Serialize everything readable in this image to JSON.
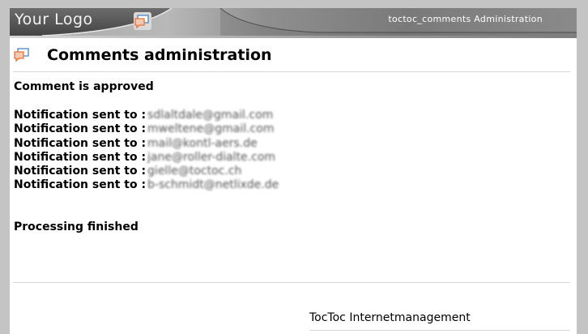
{
  "header": {
    "logo_text": "Your Logo",
    "title": "toctoc_comments Administration",
    "icon": "comments-icon"
  },
  "page": {
    "title": "Comments administration",
    "icon": "comments-icon"
  },
  "content": {
    "status": "Comment is approved",
    "notifications": [
      {
        "label": "Notification sent to :",
        "email": "sdlaltdale@gmail.com"
      },
      {
        "label": "Notification sent to :",
        "email": "mweltene@gmail.com"
      },
      {
        "label": "Notification sent to :",
        "email": "mail@kontl-aers.de"
      },
      {
        "label": "Notification sent to :",
        "email": "jane@roller-dialte.com"
      },
      {
        "label": "Notification sent to :",
        "email": "gielle@toctoc.ch"
      },
      {
        "label": "Notification sent to :",
        "email": "b-schmidt@netlixde.de"
      }
    ],
    "finished": "Processing finished"
  },
  "footer": {
    "company": "TocToc Internetmanagement"
  },
  "colors": {
    "icon_orange": "#e8733a",
    "icon_blue": "#4a7fc0"
  }
}
